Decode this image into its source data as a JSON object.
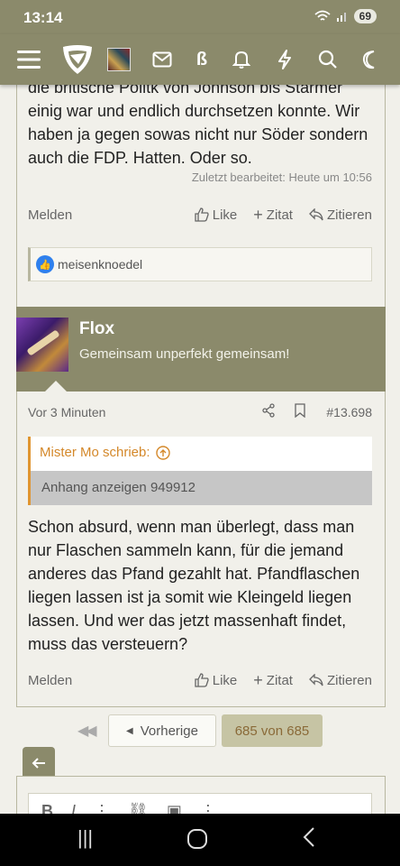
{
  "status": {
    "time": "13:14",
    "battery": "69"
  },
  "nav": {
    "icons": [
      "menu-icon",
      "site-logo",
      "user-avatar",
      "mail-icon",
      "eszett-icon",
      "bell-icon",
      "bolt-icon",
      "search-icon",
      "moon-icon"
    ],
    "eszett_glyph": "ß"
  },
  "post1": {
    "text": "die britische Politk von Johnson bis Starmer einig war und endlich durchsetzen konnte. Wir haben ja gegen sowas nicht nur Söder sondern auch die FDP. Hatten. Oder so.",
    "edited": "Zuletzt bearbeitet: Heute um 10:56",
    "report": "Melden",
    "like": "Like",
    "quote": "Zitat",
    "reply": "Zitieren",
    "reactions_user": "meisenknoedel"
  },
  "post2": {
    "username": "Flox",
    "usertitle": "Gemeinsam unperfekt gemeinsam!",
    "time": "Vor 3 Minuten",
    "number": "#13.698",
    "quote_author": "Mister Mo schrieb:",
    "quote_attachment": "Anhang anzeigen 949912",
    "text": "Schon absurd, wenn man überlegt, dass man nur Flaschen sammeln kann, für die jemand anderes das Pfand gezahlt hat. Pfandflaschen liegen lassen ist ja somit wie Kleingeld liegen lassen. Und wer das jetzt massenhaft findet, muss das versteuern?",
    "report": "Melden",
    "like": "Like",
    "quote": "Zitat",
    "reply": "Zitieren"
  },
  "pagination": {
    "prev": "Vorherige",
    "current": "685 von 685"
  },
  "colors": {
    "header": "#8b8a6b",
    "background": "#f1f0ea",
    "quote_accent": "#e09530",
    "like_blue": "#2f80ed"
  }
}
